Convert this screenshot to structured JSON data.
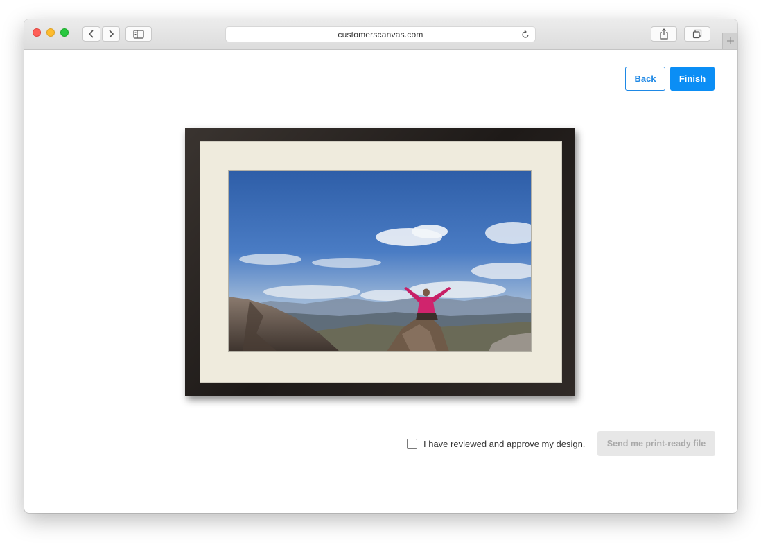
{
  "browser": {
    "url": "customerscanvas.com",
    "icons": {
      "close": "red-dot",
      "minimize": "yellow-dot",
      "zoom": "green-dot",
      "back": "chevron-left-icon",
      "forward": "chevron-right-icon",
      "sidebar": "sidebar-icon",
      "reload": "reload-icon",
      "share": "share-icon",
      "tabs": "tabs-icon",
      "new_tab": "plus-icon"
    }
  },
  "actions": {
    "back_label": "Back",
    "finish_label": "Finish"
  },
  "approval": {
    "checkbox_label": "I have reviewed and approve my design.",
    "checked": false,
    "send_label": "Send me print-ready file",
    "send_enabled": false
  },
  "colors": {
    "accent": "#0b8ef5",
    "frame": "#231f1c",
    "mat": "#efebdd",
    "disabled_bg": "#e7e7e7",
    "disabled_text": "#a9a9a9"
  }
}
